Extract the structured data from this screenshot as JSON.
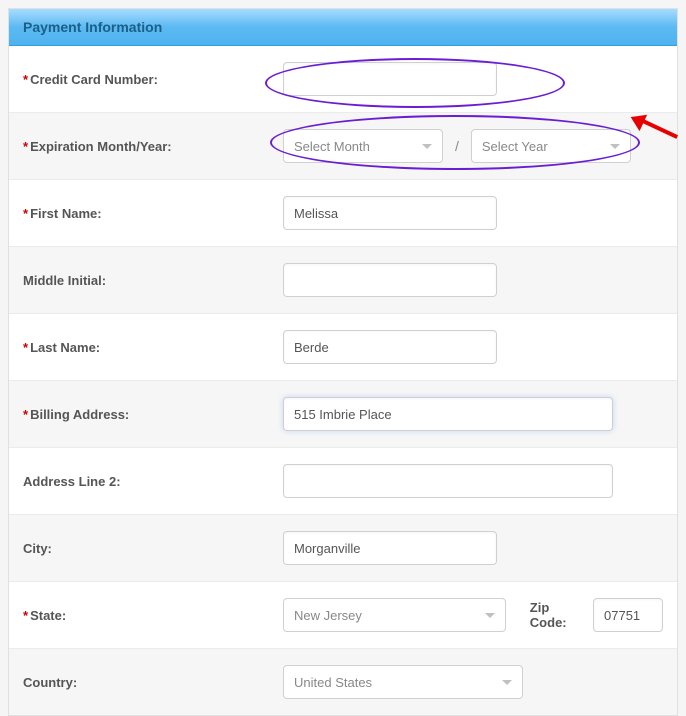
{
  "header": {
    "title": "Payment Information"
  },
  "fields": {
    "credit_card": {
      "label": "Credit Card Number:",
      "required": true,
      "value": ""
    },
    "expiration": {
      "label": "Expiration Month/Year:",
      "required": true,
      "month_placeholder": "Select Month",
      "year_placeholder": "Select Year"
    },
    "first_name": {
      "label": "First Name:",
      "required": true,
      "value": "Melissa"
    },
    "middle_initial": {
      "label": "Middle Initial:",
      "required": false,
      "value": ""
    },
    "last_name": {
      "label": "Last Name:",
      "required": true,
      "value": "Berde"
    },
    "billing_address": {
      "label": "Billing Address:",
      "required": true,
      "value": "515 Imbrie Place"
    },
    "address_line_2": {
      "label": "Address Line 2:",
      "required": false,
      "value": ""
    },
    "city": {
      "label": "City:",
      "required": false,
      "value": "Morganville"
    },
    "state": {
      "label": "State:",
      "required": true,
      "value": "New Jersey"
    },
    "zip": {
      "label": "Zip Code:",
      "value": "07751"
    },
    "country": {
      "label": "Country:",
      "required": false,
      "value": "United States"
    }
  },
  "misc": {
    "slash": "/",
    "asterisk": "*"
  }
}
